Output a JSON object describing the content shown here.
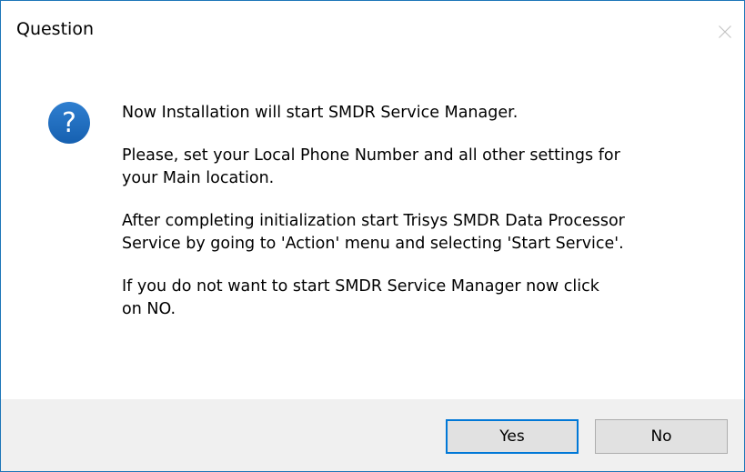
{
  "window": {
    "title": "Question",
    "close_icon": "close-icon",
    "question_icon": "question-icon",
    "accent_color": "#1e76b8"
  },
  "message": {
    "line1": "Now Installation will start SMDR Service Manager.",
    "para2_line1": "Please, set your Local Phone Number and all other settings for",
    "para2_line2": "your Main location.",
    "para3_line1": "After completing initialization start Trisys SMDR Data Processor",
    "para3_line2": "Service by going to 'Action' menu and selecting 'Start Service'.",
    "para4_line1": "If you do not want to start SMDR Service Manager now click",
    "para4_line2": "on NO."
  },
  "buttons": {
    "yes_label": "Yes",
    "no_label": "No"
  }
}
